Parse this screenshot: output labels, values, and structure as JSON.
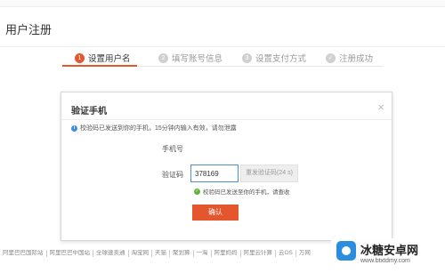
{
  "top_strip": {
    "left": "",
    "right": ""
  },
  "page_title": "用户注册",
  "steps": [
    {
      "num": "1",
      "label": "设置用户名",
      "active": true
    },
    {
      "num": "2",
      "label": "填写账号信息",
      "active": false
    },
    {
      "num": "3",
      "label": "设置支付方式",
      "active": false
    },
    {
      "num": "✓",
      "label": "注册成功",
      "active": false
    }
  ],
  "modal": {
    "title": "验证手机",
    "close_icon": "×",
    "notice": "校验码已发送到你的手机，15分钟内输入有效，请勿泄露",
    "phone_label": "手机号",
    "phone_value": "",
    "code_label": "验证码",
    "code_value": "378169",
    "resend_label": "重发验证码(24 s)",
    "sent_note": "校验码已发送至你的手机，请查收",
    "confirm_label": "确认"
  },
  "footer_links": [
    "阿里巴巴国际站",
    "阿里巴巴中国站",
    "全球速卖通",
    "淘宝网",
    "天猫",
    "聚划算",
    "一淘",
    "阿里妈妈",
    "阿里云计算",
    "云OS",
    "万网"
  ],
  "watermark": {
    "title": "冰糖安卓网",
    "url": "www.btxtdmy.com"
  },
  "colors": {
    "accent": "#e4572e",
    "info": "#3b8ee0",
    "success": "#5fb336"
  }
}
